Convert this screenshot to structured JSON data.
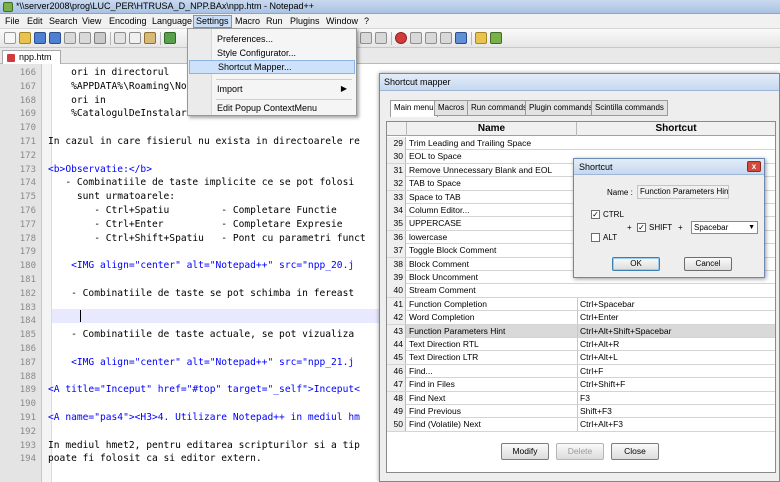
{
  "window": {
    "title": "*\\\\server2008\\prog\\LUC_PER\\HTRUSA_D_NPP.BAx\\npp.htm - Notepad++"
  },
  "menu": [
    "File",
    "Edit",
    "Search",
    "View",
    "Encoding",
    "Language",
    "Settings",
    "Macro",
    "Run",
    "Plugins",
    "Window",
    "?"
  ],
  "tab": {
    "label": "npp.htm"
  },
  "editor": {
    "line_numbers": [
      "166",
      "167",
      "168",
      "169",
      "170",
      "171",
      "172",
      "173",
      "174",
      "175",
      "176",
      "177",
      "178",
      "179",
      "180",
      "181",
      "182",
      "183",
      "184",
      "185",
      "186",
      "187",
      "188",
      "189",
      "190",
      "191",
      "192",
      "193",
      "194"
    ],
    "lines": [
      "    ori in directorul",
      "    %APPDATA%\\Roaming\\Not",
      "    ori in",
      "    %CatalogulDeInstalare",
      "",
      "In cazul in care fisierul nu exista in directoarele re",
      "",
      "<b>Observatie:</b>",
      "   - Combinatiile de taste implicite ce se pot folosi",
      "     sunt urmatoarele:",
      "        - Ctrl+Spatiu         - Completare Functie",
      "        - Ctrl+Enter          - Completare Expresie",
      "        - Ctrl+Shift+Spatiu   - Pont cu parametri funct",
      "",
      "    <IMG align=\"center\" alt=\"Notepad++\" src=\"npp_20.j",
      "",
      "    - Combinatiile de taste se pot schimba in fereast",
      "",
      "",
      "    - Combinatiile de taste actuale, se pot vizualiza",
      "",
      "    <IMG align=\"center\" alt=\"Notepad++\" src=\"npp_21.j",
      "",
      "<A title=\"Inceput\" href=\"#top\" target=\"_self\">Inceput<",
      "",
      "<A name=\"pas4\"><H3>4. Utilizare Notepad++ in mediul hm",
      "",
      "In mediul hmet2, pentru editarea scripturilor si a tip",
      "poate fi folosit ca si editor extern."
    ]
  },
  "settings_menu": {
    "items": [
      "Preferences...",
      "Style Configurator...",
      "Shortcut Mapper...",
      "Import",
      "Edit Popup ContextMenu"
    ],
    "submenu_arrow": "▶"
  },
  "shortcut_mapper": {
    "title": "Shortcut mapper",
    "tabs": [
      "Main menu",
      "Macros",
      "Run commands",
      "Plugin commands",
      "Scintilla commands"
    ],
    "columns": [
      "Name",
      "Shortcut"
    ],
    "rows": [
      {
        "n": "29",
        "name": "Trim Leading and Trailing Space",
        "shortcut": ""
      },
      {
        "n": "30",
        "name": "EOL to Space",
        "shortcut": ""
      },
      {
        "n": "31",
        "name": "Remove Unnecessary Blank and EOL",
        "shortcut": ""
      },
      {
        "n": "32",
        "name": "TAB to Space",
        "shortcut": ""
      },
      {
        "n": "33",
        "name": "Space to TAB",
        "shortcut": ""
      },
      {
        "n": "34",
        "name": "Column Editor...",
        "shortcut": ""
      },
      {
        "n": "35",
        "name": "UPPERCASE",
        "shortcut": ""
      },
      {
        "n": "36",
        "name": "lowercase",
        "shortcut": ""
      },
      {
        "n": "37",
        "name": "Toggle Block Comment",
        "shortcut": ""
      },
      {
        "n": "38",
        "name": "Block Comment",
        "shortcut": ""
      },
      {
        "n": "39",
        "name": "Block Uncomment",
        "shortcut": ""
      },
      {
        "n": "40",
        "name": "Stream Comment",
        "shortcut": ""
      },
      {
        "n": "41",
        "name": "Function Completion",
        "shortcut": "Ctrl+Spacebar"
      },
      {
        "n": "42",
        "name": "Word Completion",
        "shortcut": "Ctrl+Enter"
      },
      {
        "n": "43",
        "name": "Function Parameters Hint",
        "shortcut": "Ctrl+Alt+Shift+Spacebar"
      },
      {
        "n": "44",
        "name": "Text Direction RTL",
        "shortcut": "Ctrl+Alt+R"
      },
      {
        "n": "45",
        "name": "Text Direction LTR",
        "shortcut": "Ctrl+Alt+L"
      },
      {
        "n": "46",
        "name": "Find...",
        "shortcut": "Ctrl+F"
      },
      {
        "n": "47",
        "name": "Find in Files",
        "shortcut": "Ctrl+Shift+F"
      },
      {
        "n": "48",
        "name": "Find Next",
        "shortcut": "F3"
      },
      {
        "n": "49",
        "name": "Find Previous",
        "shortcut": "Shift+F3"
      },
      {
        "n": "50",
        "name": "Find (Volatile) Next",
        "shortcut": "Ctrl+Alt+F3"
      }
    ],
    "selected_row": "43",
    "buttons": {
      "modify": "Modify",
      "delete": "Delete",
      "close": "Close"
    }
  },
  "shortcut_dialog": {
    "title": "Shortcut",
    "name_label": "Name :",
    "name_value": "Function Parameters Hint",
    "ctrl_label": "CTRL",
    "ctrl_checked": true,
    "alt_label": "ALT",
    "alt_checked": false,
    "shift_label": "SHIFT",
    "shift_checked": true,
    "plus": "+",
    "key_value": "Spacebar",
    "ok_label": "OK",
    "cancel_label": "Cancel",
    "close_glyph": "x",
    "check_glyph": "✓"
  },
  "colors": {
    "tag_blue": "#0000ff",
    "selected_row": "#d9d9d9",
    "menu_highlight": "#cde2fa"
  }
}
